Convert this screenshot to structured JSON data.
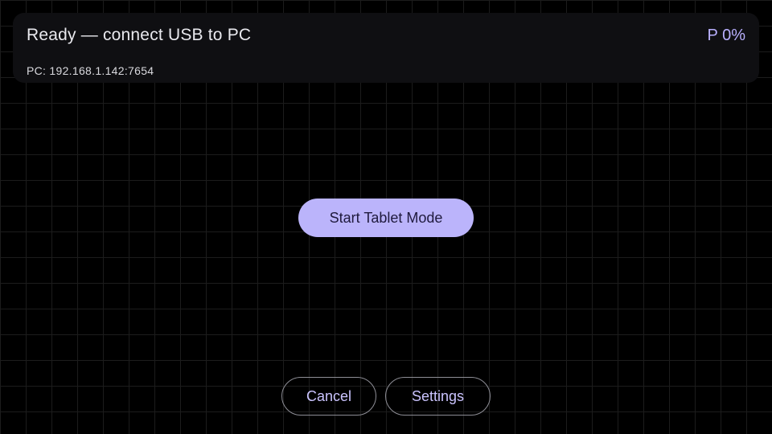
{
  "status_card": {
    "message": "Ready — connect USB to PC",
    "pressure": "P 0%",
    "pc_address": "PC: 192.168.1.142:7654"
  },
  "main": {
    "start_label": "Start Tablet Mode"
  },
  "footer": {
    "cancel_label": "Cancel",
    "settings_label": "Settings"
  },
  "colors": {
    "background": "#000000",
    "card": "#0f0f12",
    "accent": "#bbb4fb",
    "accent_text": "#b9b0ff",
    "outline": "#8e8e96"
  }
}
